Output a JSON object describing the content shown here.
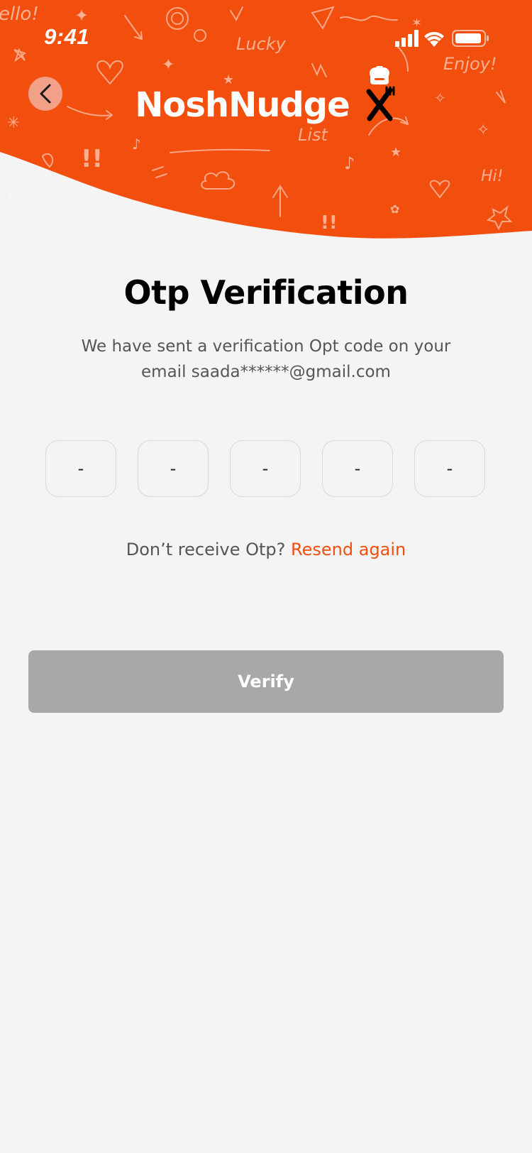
{
  "status_bar": {
    "time": "9:41",
    "icons": [
      "cellular-signal-icon",
      "wifi-icon",
      "battery-icon"
    ]
  },
  "header": {
    "back_icon": "chevron-left-icon",
    "brand_name": "NoshNudge",
    "brand_logo_icon": "chef-hat-fork-knife-icon",
    "doodles": [
      "ello!",
      "Lucky",
      "Enjoy!",
      "List",
      "Hi!",
      "Ok!"
    ]
  },
  "main": {
    "title": "Otp Verification",
    "subtitle": "We have sent a verification Opt code on your email saada******@gmail.com",
    "otp_digits": [
      "-",
      "-",
      "-",
      "-",
      "-"
    ],
    "resend_prompt": "Don’t receive Otp?",
    "resend_link": "Resend again",
    "verify_label": "Verify"
  },
  "colors": {
    "brand_orange": "#f24e0e",
    "background": "#f4f4f4",
    "button_disabled": "#a8a8a8",
    "back_button_bg": "#f3a088"
  }
}
